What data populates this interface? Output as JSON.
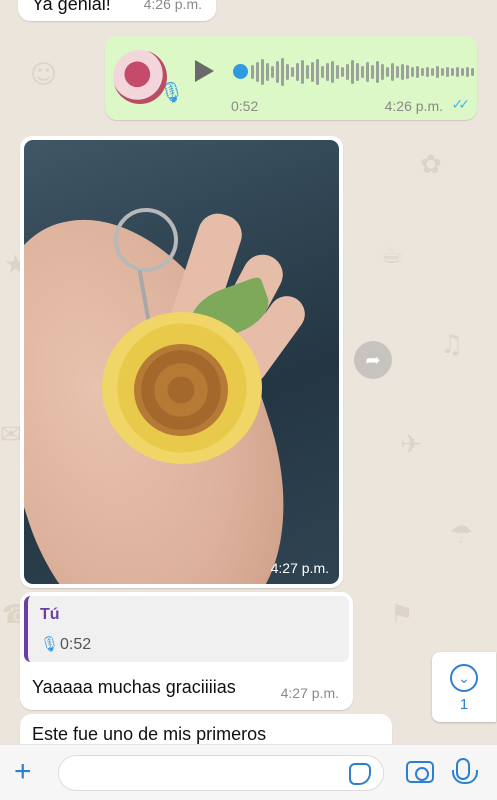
{
  "messages": {
    "top": {
      "text": "Ya genial!",
      "time": "4:26 p.m."
    },
    "voice": {
      "duration": "0:52",
      "time": "4:26 p.m.",
      "status_icon": "double-check-icon"
    },
    "image": {
      "time": "4:27 p.m."
    },
    "reply": {
      "quote_author": "Tú",
      "quote_duration": "0:52",
      "text": "Yaaaaa muchas graciiiias",
      "time": "4:27 p.m."
    },
    "last": {
      "text": "Este fue uno de mis primeros"
    }
  },
  "scroll_down": {
    "count": "1"
  },
  "colors": {
    "outgoing_bubble": "#dcf8c6",
    "incoming_bubble": "#ffffff",
    "accent": "#2f7fd0",
    "quote_author": "#6b3fa0"
  }
}
